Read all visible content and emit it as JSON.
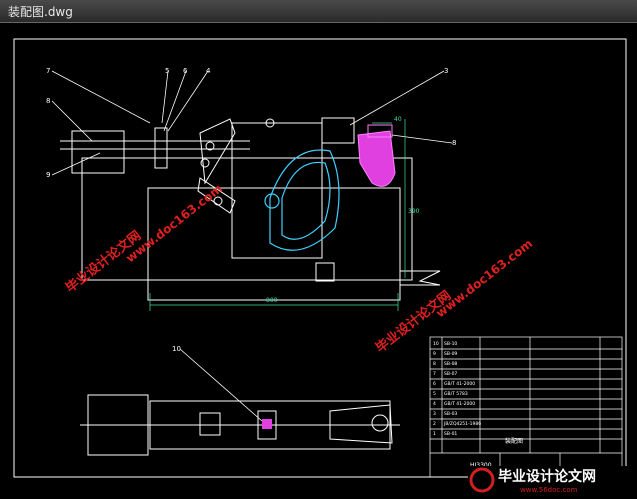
{
  "window": {
    "title": "装配图.dwg"
  },
  "callouts": [
    "7",
    "5",
    "6",
    "4",
    "3",
    "8",
    "8",
    "9",
    "10"
  ],
  "dimensions": {
    "overall_width": "800",
    "height": "390",
    "pin_dim": "40"
  },
  "title_block": {
    "drawing_name": "装配图",
    "model": "HJ3300"
  },
  "parts_list": {
    "rows": [
      {
        "no": "10",
        "name": "SB-10"
      },
      {
        "no": "9",
        "name": "SB-09"
      },
      {
        "no": "8",
        "name": "SB-08"
      },
      {
        "no": "7",
        "name": "SB-07"
      },
      {
        "no": "6",
        "name": "GB/T 41-2000"
      },
      {
        "no": "5",
        "name": "GB/T 5783"
      },
      {
        "no": "4",
        "name": "GB/T 41-2000"
      },
      {
        "no": "3",
        "name": "SB-03"
      },
      {
        "no": "2",
        "name": "JB/ZQ4251-1986"
      },
      {
        "no": "1",
        "name": "SB-01"
      }
    ]
  },
  "watermarks": {
    "site_cn": "毕业设计论文网",
    "site_url": "www.doc163.com",
    "footer_cn": "毕业设计论文网",
    "footer_url": "www.56doc.com"
  },
  "colors": {
    "outline": "#ffffff",
    "leader": "#ffffff",
    "part_magenta": "#e040e0",
    "part_cyan": "#40d0ff",
    "watermark_red": "#e02020"
  }
}
